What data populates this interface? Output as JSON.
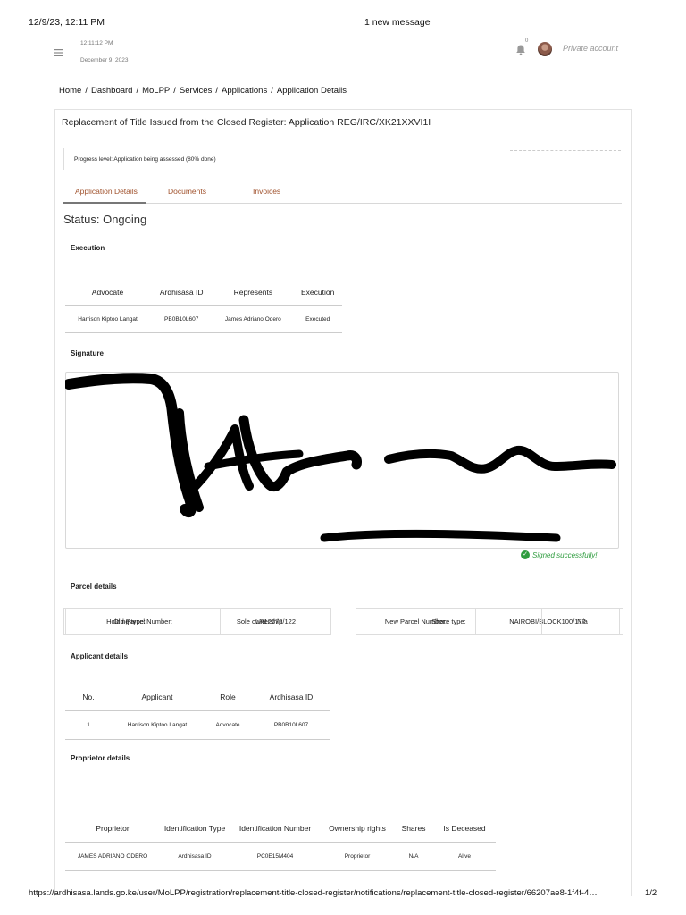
{
  "print": {
    "datetime": "12/9/23, 12:11 PM",
    "title": "1 new message",
    "url": "https://ardhisasa.lands.go.ke/user/MoLPP/registration/replacement-title-closed-register/notifications/replacement-title-closed-register/66207ae8-1f4f-4…",
    "page": "1/2"
  },
  "topbar": {
    "time": "12:11:12 PM",
    "date": "December 9, 2023",
    "notification_count": "0",
    "account": "Private account"
  },
  "breadcrumb": [
    "Home",
    "Dashboard",
    "MoLPP",
    "Services",
    "Applications",
    "Application Details"
  ],
  "card": {
    "title": "Replacement of Title Issued from the Closed Register: Application REG/IRC/XK21XXVI1I",
    "progress": "Progress level: Application being assessed (80% done)",
    "progress_percent": 80,
    "tabs": [
      "Application Details",
      "Documents",
      "Invoices"
    ],
    "active_tab": "Application Details",
    "status": "Status: Ongoing"
  },
  "execution": {
    "heading": "Execution",
    "columns": [
      "Advocate",
      "Ardhisasa ID",
      "Represents",
      "Execution"
    ],
    "rows": [
      [
        "Harrison Kiptoo Langat",
        "PB0B10L607",
        "James Adriano Odero",
        "Executed"
      ]
    ]
  },
  "signature": {
    "heading": "Signature",
    "signed_text": "Signed successfully!"
  },
  "parcel": {
    "heading": "Parcel details",
    "old_label": "Old Parcel Number:",
    "old_value": "LR12672/122",
    "new_label": "New Parcel Number:",
    "new_value": "NAIROBI/BLOCK100/177"
  },
  "applicant": {
    "heading": "Applicant details",
    "columns": [
      "No.",
      "Applicant",
      "Role",
      "Ardhisasa ID"
    ],
    "rows": [
      [
        "1",
        "Harrison Kiptoo Langat",
        "Advocate",
        "PB0B10L607"
      ]
    ]
  },
  "proprietor": {
    "heading": "Proprietor details",
    "holding_label": "Holding type:",
    "holding_value": "Sole ownership",
    "share_label": "Share type:",
    "share_value": "N/a",
    "columns": [
      "Proprietor",
      "Identification Type",
      "Identification Number",
      "Ownership rights",
      "Shares",
      "Is Deceased"
    ],
    "rows": [
      [
        "JAMES ADRIANO ODERO",
        "Ardhisasa ID",
        "PC0E15M404",
        "Proprietor",
        "N/A",
        "Alive"
      ]
    ]
  }
}
